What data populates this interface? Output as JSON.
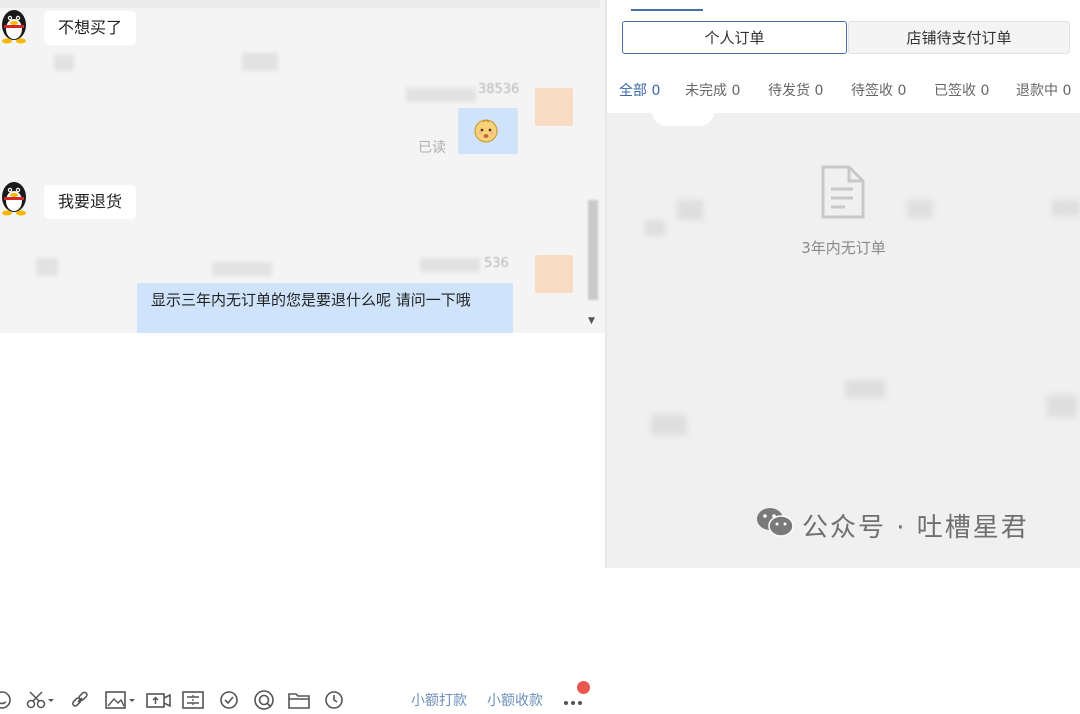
{
  "chat": {
    "messages": [
      {
        "direction": "incoming",
        "text": "不想买了"
      },
      {
        "direction": "outgoing",
        "sender_id": "38536",
        "status": "已读",
        "content": "emoji-baby-face-icon"
      },
      {
        "direction": "incoming",
        "text": "我要退货"
      },
      {
        "direction": "outgoing",
        "sender_id": "536",
        "text": "显示三年内无订单的您是要退什么呢 请问一下哦"
      }
    ],
    "toolbar": {
      "tools": [
        "smile-icon",
        "scissors-icon",
        "link-icon",
        "image-icon",
        "video-upload-icon",
        "ticket-icon",
        "shield-check-icon",
        "coupon-icon",
        "folder-icon",
        "clock-icon"
      ],
      "small_pay_label": "小额打款",
      "small_collect_label": "小额收款",
      "more_badge_color": "#e9574f"
    }
  },
  "orders": {
    "segments": {
      "personal": "个人订单",
      "shop": "店铺待支付订单"
    },
    "tabs": [
      {
        "label": "全部 0",
        "active": true
      },
      {
        "label": "未完成 0"
      },
      {
        "label": "待发货 0"
      },
      {
        "label": "待签收 0"
      },
      {
        "label": "已签收 0"
      },
      {
        "label": "退款中 0"
      }
    ],
    "empty_text": "3年内无订单"
  },
  "watermark": {
    "text": "公众号 · 吐槽星君"
  },
  "colors": {
    "accent": "#4a6fa5",
    "outgoing_bubble": "#cfe4fb",
    "link": "#6b8fb8"
  }
}
